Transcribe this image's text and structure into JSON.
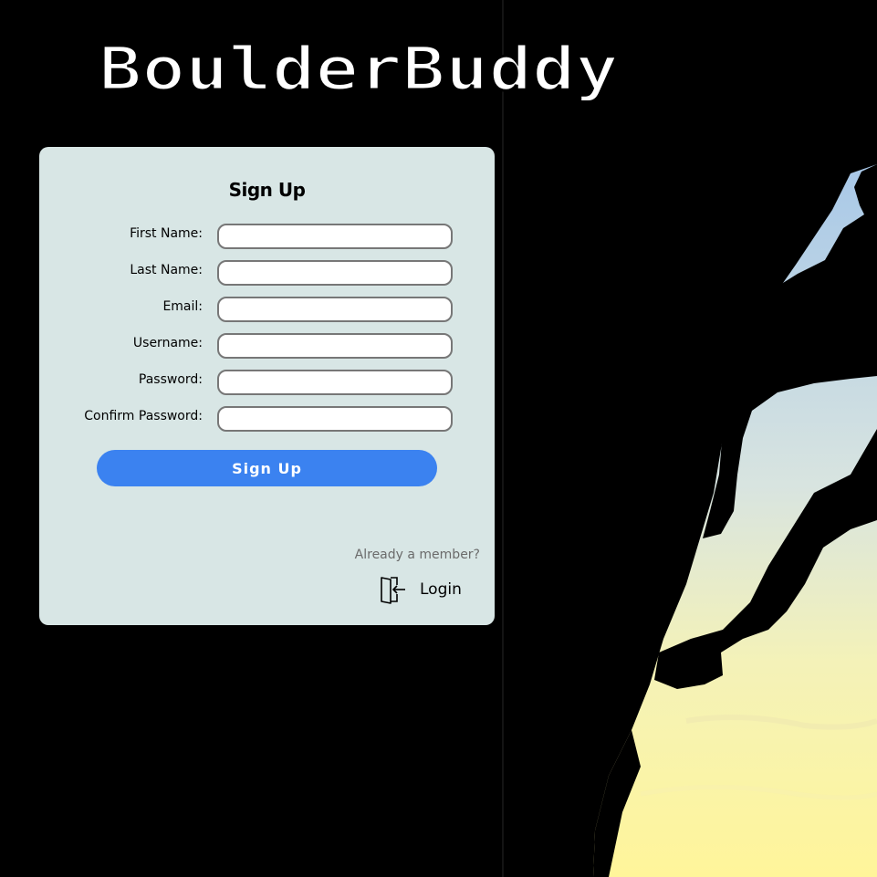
{
  "app": {
    "logo_text": "BoulderBuddy"
  },
  "signup": {
    "title": "Sign Up",
    "fields": [
      {
        "label": "First Name:",
        "value": ""
      },
      {
        "label": "Last Name:",
        "value": ""
      },
      {
        "label": "Email:",
        "value": ""
      },
      {
        "label": "Username:",
        "value": ""
      },
      {
        "label": "Password:",
        "value": ""
      },
      {
        "label": "Confirm Password:",
        "value": ""
      }
    ],
    "submit_label": "Sign Up",
    "member_prompt": "Already a member?",
    "login_label": "Login",
    "login_icon": "door-enter-icon"
  },
  "hero": {
    "image": "climber-silhouette-at-dusk",
    "colors": {
      "sky_top": "#a8c8e8",
      "sky_bottom": "#fff5a0",
      "silhouette": "#000000"
    }
  },
  "colors": {
    "background": "#000000",
    "card": "#d8e6e5",
    "accent": "#3b82f0",
    "muted_text": "#6b6b6b"
  }
}
